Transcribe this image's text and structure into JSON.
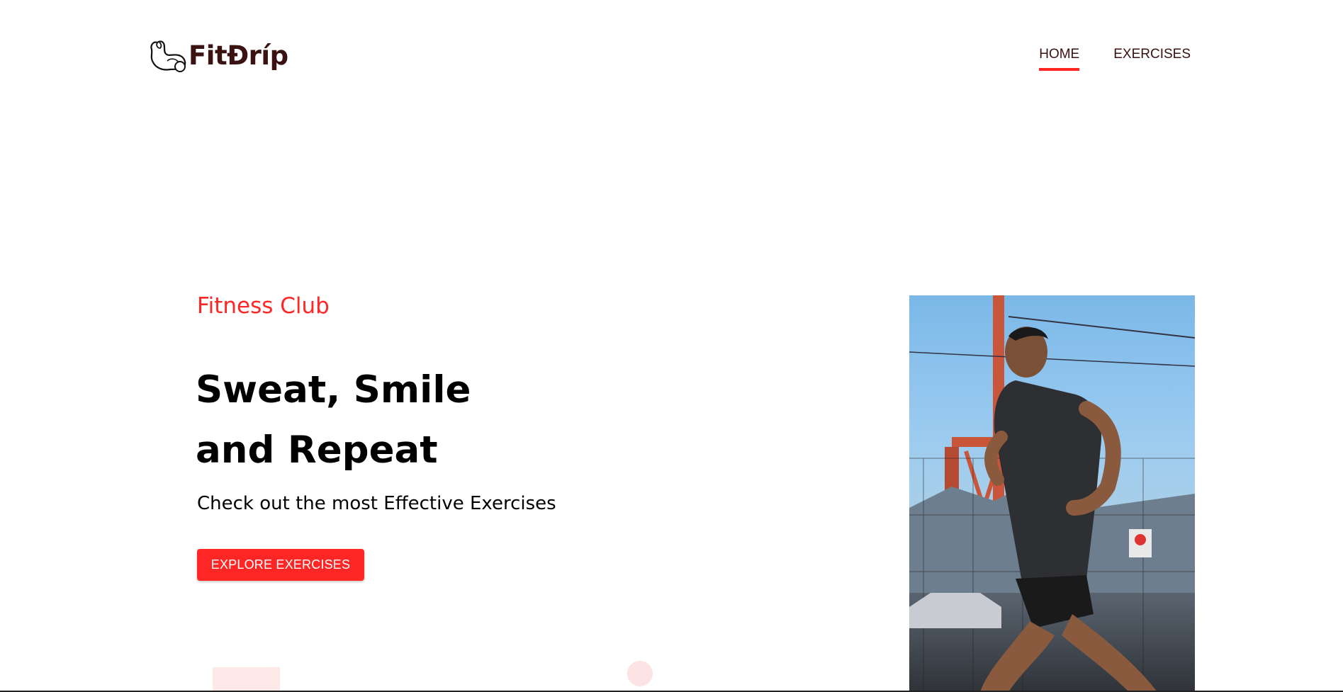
{
  "navbar": {
    "logo_text": "FitĐríp",
    "links": [
      {
        "label": "HOME",
        "active": true
      },
      {
        "label": "EXERCISES",
        "active": false
      }
    ]
  },
  "hero": {
    "subtitle": "Fitness Club",
    "title_line1": "Sweat, Smile",
    "title_line2": "and Repeat",
    "description": "Check out the most Effective Exercises",
    "button_label": "EXPLORE EXERCISES"
  },
  "colors": {
    "accent": "#ff2625",
    "brand_text": "#3a1212"
  }
}
